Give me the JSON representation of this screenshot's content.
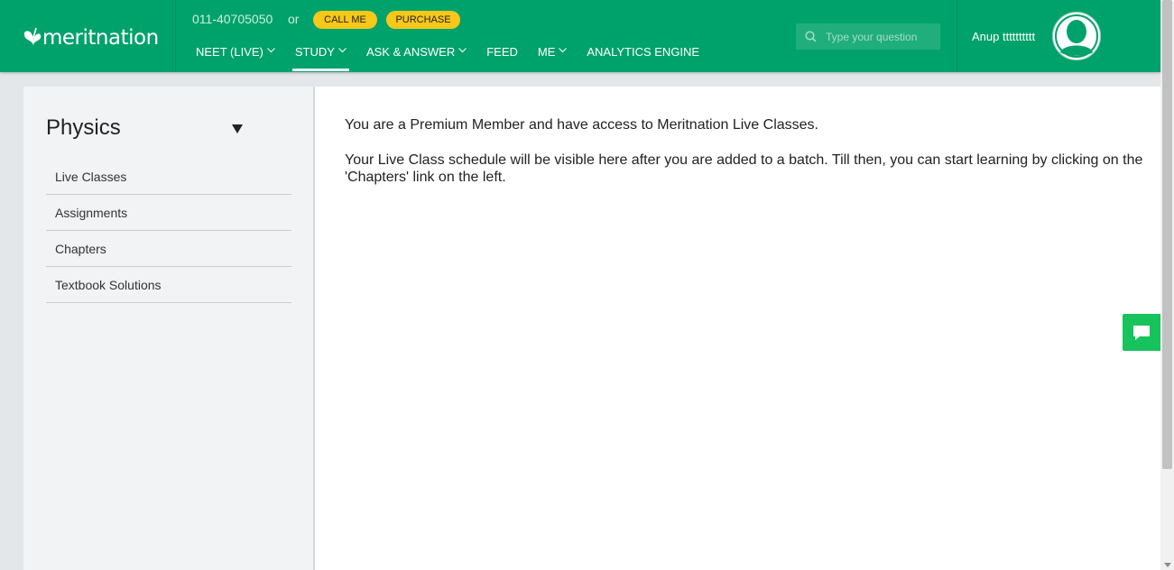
{
  "brand": {
    "name": "meritnation"
  },
  "contact": {
    "phone": "011-40705050",
    "or_text": "or",
    "call_label": "CALL ME",
    "purchase_label": "PURCHASE"
  },
  "nav": [
    {
      "label": "NEET (LIVE)",
      "has_dropdown": true
    },
    {
      "label": "STUDY",
      "has_dropdown": true,
      "active": true
    },
    {
      "label": "ASK & ANSWER",
      "has_dropdown": true
    },
    {
      "label": "FEED",
      "has_dropdown": false
    },
    {
      "label": "ME",
      "has_dropdown": true
    },
    {
      "label": "ANALYTICS ENGINE",
      "has_dropdown": false
    }
  ],
  "search": {
    "placeholder": "Type your question",
    "icon": "search-icon"
  },
  "user": {
    "name": "Anup tttttttttt",
    "icon": "user-avatar-icon"
  },
  "sidebar": {
    "subject": "Physics",
    "items": [
      {
        "label": "Live Classes"
      },
      {
        "label": "Assignments"
      },
      {
        "label": "Chapters"
      },
      {
        "label": "Textbook Solutions"
      }
    ]
  },
  "main": {
    "message_1": "You are a Premium Member and have access to Meritnation Live Classes.",
    "message_2": "Your Live Class schedule will be visible here after you are added to a batch. Till then, you can start learning by clicking on the 'Chapters' link on the left."
  },
  "colors": {
    "brand_green": "#00a26b",
    "accent_yellow": "#f7c719",
    "chat_green": "#16c35c"
  }
}
